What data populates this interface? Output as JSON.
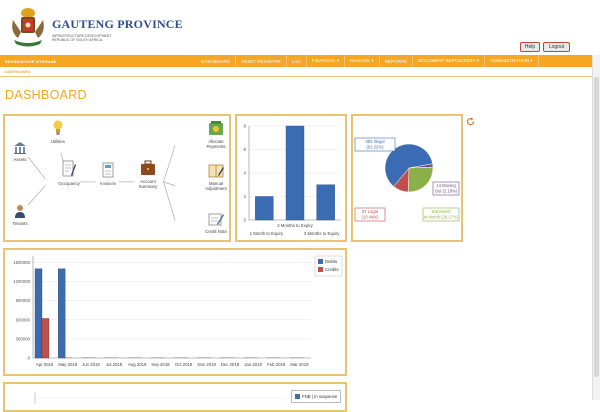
{
  "header": {
    "brand_title": "GAUTENG PROVINCE",
    "brand_line1": "INFRASTRUCTURE DEVELOPMENT",
    "brand_line2": "REPUBLIC OF SOUTH AFRICA",
    "help_label": "Help",
    "logout_label": "Logout"
  },
  "nav": {
    "user": "SEHABATUOE NTSHANE",
    "items": [
      {
        "label": "DASHBOARD"
      },
      {
        "label": "ASSET REGISTER"
      },
      {
        "label": "LAC"
      },
      {
        "label": "FINANCIAL ▾"
      },
      {
        "label": "MANAGE ▾"
      },
      {
        "label": "REPORTS"
      },
      {
        "label": "DOCUMENT REPOSITORY ▾"
      },
      {
        "label": "ADMINISTRATION ▾"
      }
    ]
  },
  "breadcrumb": "DASHBOARD",
  "page_title": "DASHBOARD",
  "flow": {
    "assets": "Assets",
    "tenants": "Tenants",
    "utilities": "Utilities",
    "occupancy": "Occupancy",
    "invoices": "Invoices",
    "account_summary_1": "Account",
    "account_summary_2": "Summary",
    "allocate_1": "Allocate",
    "allocate_2": "Payments",
    "manual_1": "Manual",
    "manual_2": "Adjustment",
    "credit_note": "Credit Note"
  },
  "chart_data": [
    {
      "type": "bar",
      "categories": [
        "1 Month to Expiry",
        "2 Months to Expiry",
        "3 Months to Expiry"
      ],
      "values": [
        2,
        8,
        3
      ],
      "ylim": [
        0,
        8
      ],
      "yticks": [
        0,
        2,
        4,
        6,
        8
      ]
    },
    {
      "type": "pie",
      "slices": [
        {
          "label": "393 Illegal (61.22%)",
          "value": 61.22,
          "color": "#3b6cb3"
        },
        {
          "label": "14 Moving Out (2.18%)",
          "value": 2.18,
          "color": "#6e4a8e"
        },
        {
          "label": "168 Month to Month (26.17%)",
          "value": 26.17,
          "color": "#8bb04a"
        },
        {
          "label": "67 Legal (10.44%)",
          "value": 10.44,
          "color": "#c0504d"
        }
      ]
    },
    {
      "type": "bar",
      "categories": [
        "Apr 2018",
        "May 2018",
        "Jun 2018",
        "Jul 2018",
        "Aug 2018",
        "Sep 2018",
        "Oct 2018",
        "Nov 2018",
        "Dec 2018",
        "Jan 2019",
        "Feb 2019",
        "Mar 2019"
      ],
      "series": [
        {
          "name": "Debits",
          "values": [
            1400000,
            1400000,
            0,
            0,
            0,
            0,
            0,
            0,
            0,
            0,
            0,
            0
          ],
          "color": "#3b6cb3"
        },
        {
          "name": "Credits",
          "values": [
            620000,
            0,
            0,
            0,
            0,
            0,
            0,
            0,
            0,
            0,
            0,
            0
          ],
          "color": "#c0504d"
        }
      ],
      "ylim": [
        0,
        1600000
      ],
      "yticks": [
        0,
        300000,
        600000,
        900000,
        1200000,
        1500000
      ]
    }
  ],
  "bottom_legend": "FNB | In suspense"
}
